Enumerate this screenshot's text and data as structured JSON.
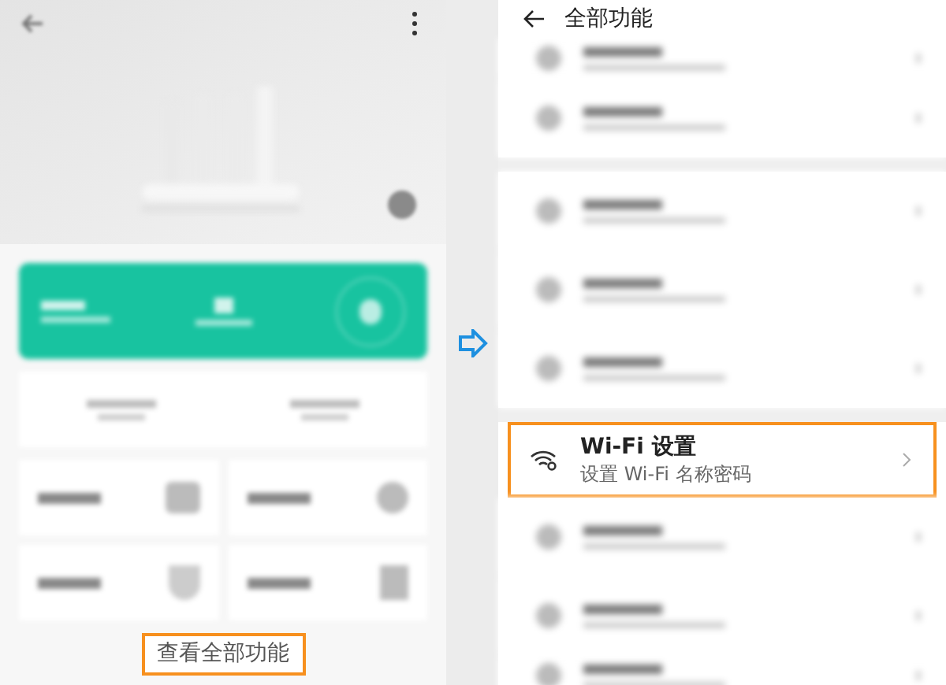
{
  "left_screen": {
    "view_all_button": {
      "label": "查看全部功能",
      "highlighted": true
    }
  },
  "right_screen": {
    "title": "全部功能",
    "rows": [
      {
        "kind": "short"
      },
      {
        "kind": "blurred"
      },
      {
        "kind": "separator"
      },
      {
        "kind": "blurred"
      },
      {
        "kind": "blurred"
      },
      {
        "kind": "blurred"
      },
      {
        "kind": "separator"
      },
      {
        "kind": "item",
        "title": "Wi-Fi 设置",
        "subtitle": "设置 Wi-Fi 名称密码",
        "highlighted": true
      },
      {
        "kind": "blurred"
      },
      {
        "kind": "blurred"
      },
      {
        "kind": "short"
      }
    ]
  }
}
